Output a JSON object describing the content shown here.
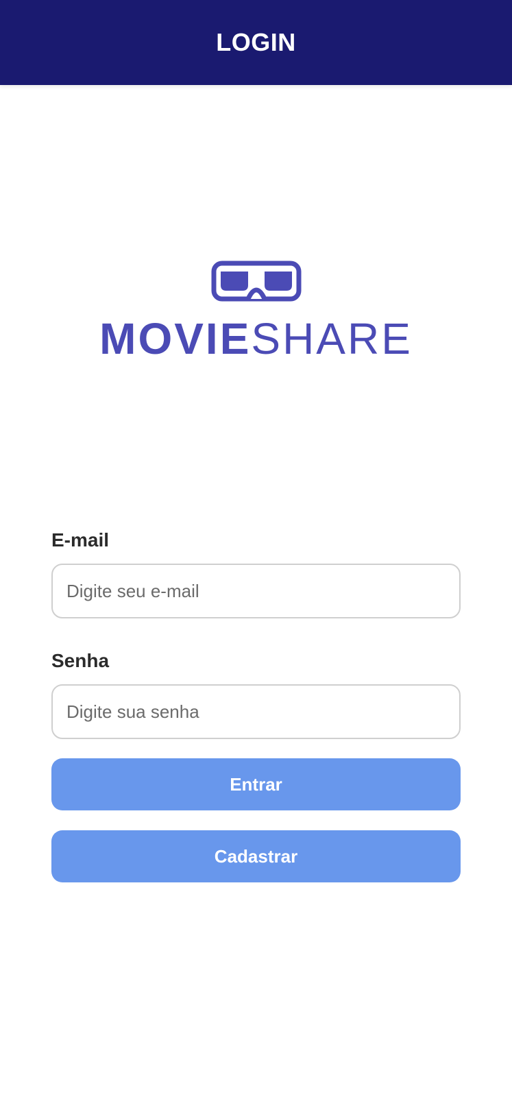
{
  "app_bar": {
    "title": "LOGIN"
  },
  "logo": {
    "icon": "3d-glasses-icon",
    "text_bold": "MOVIE",
    "text_light": "SHARE",
    "color": "#4b4bb5"
  },
  "form": {
    "email": {
      "label": "E-mail",
      "placeholder": "Digite seu e-mail",
      "value": ""
    },
    "password": {
      "label": "Senha",
      "placeholder": "Digite sua senha",
      "value": ""
    }
  },
  "buttons": {
    "login": "Entrar",
    "register": "Cadastrar"
  },
  "colors": {
    "app_bar": "#1a1a70",
    "button": "#6897ec",
    "button_text": "#ffffff"
  }
}
